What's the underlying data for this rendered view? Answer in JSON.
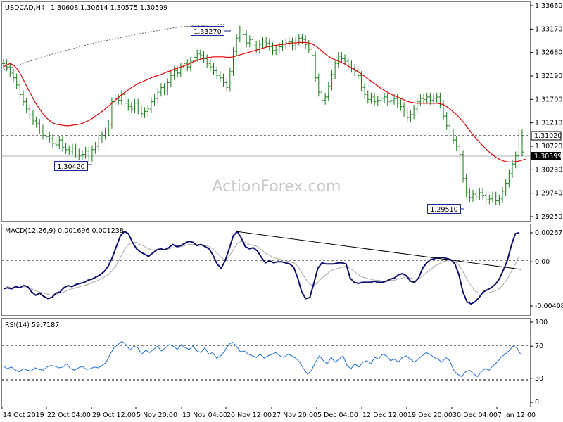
{
  "chart_data": {
    "type": "candlestick",
    "symbol": "USDCAD,H4",
    "ohlc_text": "1.30608 1.30614 1.30575 1.30599",
    "watermark": "ActionForex.com",
    "price_axis": {
      "ticks": [
        "1.33660",
        "1.33170",
        "1.32680",
        "1.32190",
        "1.31700",
        "1.31210",
        "1.30720",
        "1.30230",
        "1.29740",
        "1.29250"
      ],
      "ylim": [
        1.2925,
        1.3366
      ],
      "current_price_label": "1.30599",
      "current_price": 1.30599,
      "level_label": "1.31020",
      "level": 1.3102
    },
    "annotations": [
      {
        "text": "1.33270",
        "value": 1.3327
      },
      {
        "text": "1.30420",
        "value": 1.3042
      },
      {
        "text": "1.29510",
        "value": 1.2951
      }
    ],
    "x_labels": [
      "14 Oct 2019",
      "22 Oct 04:00",
      "29 Oct 12:00",
      "5 Nov 20:00",
      "13 Nov 04:00",
      "20 Nov 12:00",
      "27 Nov 20:00",
      "5 Dec 04:00",
      "12 Dec 12:00",
      "19 Dec 20:00",
      "30 Dec 04:00",
      "7 Jan 12:00"
    ],
    "price_series": [
      1.3245,
      1.3238,
      1.3225,
      1.3215,
      1.32,
      1.318,
      1.3165,
      1.315,
      1.3138,
      1.3125,
      1.312,
      1.3108,
      1.3095,
      1.3092,
      1.3088,
      1.3078,
      1.3075,
      1.3085,
      1.307,
      1.3065,
      1.3062,
      1.3068,
      1.3058,
      1.3052,
      1.3055,
      1.3062,
      1.3048,
      1.3065,
      1.3072,
      1.3088,
      1.3095,
      1.3102,
      1.3118,
      1.3165,
      1.3172,
      1.3168,
      1.318,
      1.3162,
      1.3155,
      1.315,
      1.3162,
      1.3148,
      1.314,
      1.3145,
      1.315,
      1.3165,
      1.3172,
      1.3185,
      1.3195,
      1.3188,
      1.3205,
      1.322,
      1.323,
      1.3225,
      1.3238,
      1.3245,
      1.3238,
      1.325,
      1.3258,
      1.3265,
      1.3262,
      1.3255,
      1.3245,
      1.3238,
      1.323,
      1.322,
      1.3215,
      1.3205,
      1.3195,
      1.3228,
      1.327,
      1.3298,
      1.3315,
      1.3305,
      1.3288,
      1.3295,
      1.3282,
      1.3275,
      1.3285,
      1.3292,
      1.3288,
      1.328,
      1.3272,
      1.3275,
      1.328,
      1.3285,
      1.3288,
      1.329,
      1.3282,
      1.3292,
      1.3298,
      1.3295,
      1.3285,
      1.3275,
      1.3262,
      1.3215,
      1.3185,
      1.3168,
      1.3175,
      1.3198,
      1.3222,
      1.3245,
      1.326,
      1.3255,
      1.325,
      1.3242,
      1.3235,
      1.3228,
      1.322,
      1.3195,
      1.318,
      1.317,
      1.3175,
      1.3165,
      1.3168,
      1.3172,
      1.3175,
      1.3165,
      1.3168,
      1.3172,
      1.3162,
      1.3155,
      1.3142,
      1.3132,
      1.3138,
      1.315,
      1.3165,
      1.3172,
      1.317,
      1.3175,
      1.3168,
      1.3172,
      1.3175,
      1.316,
      1.3135,
      1.3115,
      1.3098,
      1.3085,
      1.3072,
      1.3055,
      1.3005,
      1.2975,
      1.2965,
      1.2972,
      1.2968,
      1.2975,
      1.297,
      1.296,
      1.2962,
      1.2968,
      1.2958,
      1.2962,
      1.2978,
      1.2995,
      1.3015,
      1.3035,
      1.3052,
      1.3098,
      1.306
    ],
    "ma_series": [
      1.3238,
      1.3242,
      1.3245,
      1.3242,
      1.3235,
      1.3225,
      1.3212,
      1.3198,
      1.3185,
      1.3172,
      1.316,
      1.315,
      1.314,
      1.3132,
      1.3126,
      1.3121,
      1.3118,
      1.3117,
      1.3116,
      1.3115,
      1.3115,
      1.3116,
      1.3117,
      1.3118,
      1.312,
      1.3123,
      1.3126,
      1.313,
      1.3135,
      1.314,
      1.3145,
      1.315,
      1.3156,
      1.3162,
      1.3168,
      1.3174,
      1.318,
      1.3185,
      1.319,
      1.3195,
      1.3199,
      1.3203,
      1.3206,
      1.3209,
      1.3212,
      1.3215,
      1.3218,
      1.322,
      1.3222,
      1.3225,
      1.3228,
      1.323,
      1.3233,
      1.3235,
      1.3238,
      1.324,
      1.3243,
      1.3246,
      1.3249,
      1.3252,
      1.3254,
      1.3256,
      1.3257,
      1.3258,
      1.3259,
      1.3259,
      1.3259,
      1.3259,
      1.3258,
      1.3258,
      1.3259,
      1.3261,
      1.3263,
      1.3265,
      1.3267,
      1.3269,
      1.3271,
      1.3273,
      1.3275,
      1.3277,
      1.3279,
      1.3281,
      1.3282,
      1.3283,
      1.3284,
      1.3285,
      1.3286,
      1.3287,
      1.3288,
      1.3288,
      1.3289,
      1.3289,
      1.3289,
      1.3288,
      1.3286,
      1.3282,
      1.3277,
      1.3271,
      1.3265,
      1.326,
      1.3256,
      1.3253,
      1.325,
      1.3247,
      1.3244,
      1.324,
      1.3236,
      1.3232,
      1.3228,
      1.3223,
      1.3218,
      1.3213,
      1.3208,
      1.3203,
      1.3198,
      1.3193,
      1.3189,
      1.3185,
      1.3181,
      1.3178,
      1.3175,
      1.3172,
      1.3169,
      1.3166,
      1.3164,
      1.3163,
      1.3162,
      1.3162,
      1.3162,
      1.3162,
      1.3162,
      1.3162,
      1.3162,
      1.3161,
      1.3159,
      1.3155,
      1.315,
      1.3144,
      1.3138,
      1.3131,
      1.3123,
      1.3114,
      1.3105,
      1.3096,
      1.3088,
      1.308,
      1.3073,
      1.3066,
      1.306,
      1.3054,
      1.3049,
      1.3045,
      1.3042,
      1.304,
      1.3039,
      1.3039,
      1.304,
      1.3041,
      1.3043,
      1.3045
    ],
    "ma200_series": [
      1.3232,
      1.3262,
      1.3287,
      1.3306,
      1.3322,
      1.3327
    ],
    "macd": {
      "label": "MACD(12,26,9) 0.001696 0.001238",
      "ticks": [
        "0.002679",
        "0.00",
        "-0.004086"
      ],
      "ylim": [
        -0.0048,
        0.0032
      ],
      "main": [
        -0.0025,
        -0.0024,
        -0.0025,
        -0.0023,
        -0.0024,
        -0.0022,
        -0.0023,
        -0.0028,
        -0.0031,
        -0.0029,
        -0.0032,
        -0.0034,
        -0.0033,
        -0.0029,
        -0.0028,
        -0.0024,
        -0.0022,
        -0.0023,
        -0.0021,
        -0.002,
        -0.0019,
        -0.0017,
        -0.0016,
        -0.0014,
        -0.0012,
        -0.0009,
        -0.0004,
        0.0004,
        0.0014,
        0.0024,
        0.0028,
        0.0026,
        0.0018,
        0.0012,
        0.0009,
        0.0007,
        0.0005,
        0.0008,
        0.0011,
        0.0012,
        0.0011,
        0.0013,
        0.0016,
        0.0014,
        0.0015,
        0.0017,
        0.0019,
        0.0018,
        0.0015,
        0.0016,
        0.0014,
        0.0012,
        0.0006,
        -0.0002,
        -0.0006,
        0.0001,
        0.0012,
        0.0024,
        0.0028,
        0.0022,
        0.0014,
        0.0012,
        0.0013,
        0.001,
        0.0004,
        -0.0001,
        0.0001,
        -0.0001,
        0.0,
        0.0,
        -0.0001,
        -0.0002,
        -0.0005,
        -0.0015,
        -0.0028,
        -0.0034,
        -0.0033,
        -0.002,
        -0.0006,
        -0.0001,
        -0.0002,
        -0.0002,
        -0.0002,
        -0.0001,
        -0.0001,
        -0.0002,
        -0.0015,
        -0.0019,
        -0.002,
        -0.0019,
        -0.0019,
        -0.0019,
        -0.0018,
        -0.0019,
        -0.0019,
        -0.0018,
        -0.0016,
        -0.0015,
        -0.0012,
        -0.0011,
        -0.0013,
        -0.0018,
        -0.0019,
        -0.0015,
        -0.0006,
        -0.0001,
        0.0002,
        0.0003,
        0.0004,
        0.0004,
        0.0003,
        0.0002,
        -0.0002,
        -0.0012,
        -0.0028,
        -0.0037,
        -0.0039,
        -0.0037,
        -0.0033,
        -0.0028,
        -0.0026,
        -0.0024,
        -0.0021,
        -0.0016,
        -0.0008,
        0.0001,
        0.0015,
        0.0026,
        0.0027
      ],
      "signal": [
        -0.0022,
        -0.0023,
        -0.0024,
        -0.0024,
        -0.0024,
        -0.0024,
        -0.0024,
        -0.0025,
        -0.0027,
        -0.0028,
        -0.0029,
        -0.003,
        -0.0031,
        -0.003,
        -0.0029,
        -0.0028,
        -0.0026,
        -0.0025,
        -0.0024,
        -0.0023,
        -0.0022,
        -0.0021,
        -0.0019,
        -0.0018,
        -0.0016,
        -0.0014,
        -0.0012,
        -0.0008,
        -0.0003,
        0.0004,
        0.0011,
        0.0016,
        0.0018,
        0.0018,
        0.0016,
        0.0014,
        0.0012,
        0.0011,
        0.0011,
        0.0011,
        0.0011,
        0.0012,
        0.0013,
        0.0013,
        0.0014,
        0.0015,
        0.0016,
        0.0016,
        0.0016,
        0.0016,
        0.0015,
        0.0014,
        0.0012,
        0.0008,
        0.0004,
        0.0002,
        0.0005,
        0.0011,
        0.0017,
        0.0019,
        0.0018,
        0.0016,
        0.0015,
        0.0014,
        0.0011,
        0.0008,
        0.0006,
        0.0004,
        0.0003,
        0.0002,
        0.0001,
        0.0,
        -0.0001,
        -0.0004,
        -0.001,
        -0.0016,
        -0.0021,
        -0.0022,
        -0.0019,
        -0.0015,
        -0.0012,
        -0.0009,
        -0.0007,
        -0.0006,
        -0.0005,
        -0.0004,
        -0.0006,
        -0.0009,
        -0.0012,
        -0.0014,
        -0.0015,
        -0.0016,
        -0.0017,
        -0.0017,
        -0.0018,
        -0.0018,
        -0.0017,
        -0.0017,
        -0.0016,
        -0.0015,
        -0.0014,
        -0.0015,
        -0.0016,
        -0.0016,
        -0.0013,
        -0.001,
        -0.0007,
        -0.0004,
        -0.0002,
        0.0,
        0.0001,
        0.0001,
        0.0,
        -0.0003,
        -0.0009,
        -0.0016,
        -0.0022,
        -0.0027,
        -0.0029,
        -0.0029,
        -0.0029,
        -0.0028,
        -0.0027,
        -0.0025,
        -0.0021,
        -0.0016,
        -0.0009,
        -0.0002,
        0.0006
      ],
      "trendline": [
        [
          0.0028,
          0
        ],
        [
          -0.0007,
          1
        ]
      ]
    },
    "rsi": {
      "label": "RSI(14) 59.7187",
      "ticks": [
        "100",
        "70",
        "30",
        "0"
      ],
      "ylim": [
        0,
        100
      ],
      "series": [
        45,
        42,
        44,
        40,
        38,
        42,
        40,
        39,
        43,
        41,
        40,
        44,
        46,
        45,
        43,
        44,
        48,
        42,
        40,
        43,
        45,
        41,
        42,
        44,
        43,
        46,
        50,
        60,
        68,
        72,
        76,
        72,
        65,
        70,
        68,
        60,
        65,
        62,
        66,
        70,
        64,
        68,
        72,
        70,
        66,
        72,
        68,
        66,
        70,
        64,
        62,
        68,
        60,
        62,
        55,
        58,
        64,
        72,
        75,
        70,
        63,
        64,
        60,
        58,
        56,
        60,
        55,
        58,
        60,
        62,
        58,
        56,
        60,
        58,
        55,
        50,
        42,
        35,
        40,
        50,
        58,
        52,
        48,
        56,
        50,
        54,
        58,
        46,
        42,
        48,
        44,
        50,
        52,
        48,
        56,
        54,
        60,
        58,
        52,
        54,
        50,
        56,
        58,
        54,
        50,
        54,
        58,
        62,
        60,
        56,
        54,
        50,
        56,
        52,
        40,
        35,
        32,
        38,
        40,
        36,
        32,
        38,
        42,
        40,
        46,
        50,
        56,
        60,
        64,
        70,
        68,
        59.7
      ]
    }
  }
}
